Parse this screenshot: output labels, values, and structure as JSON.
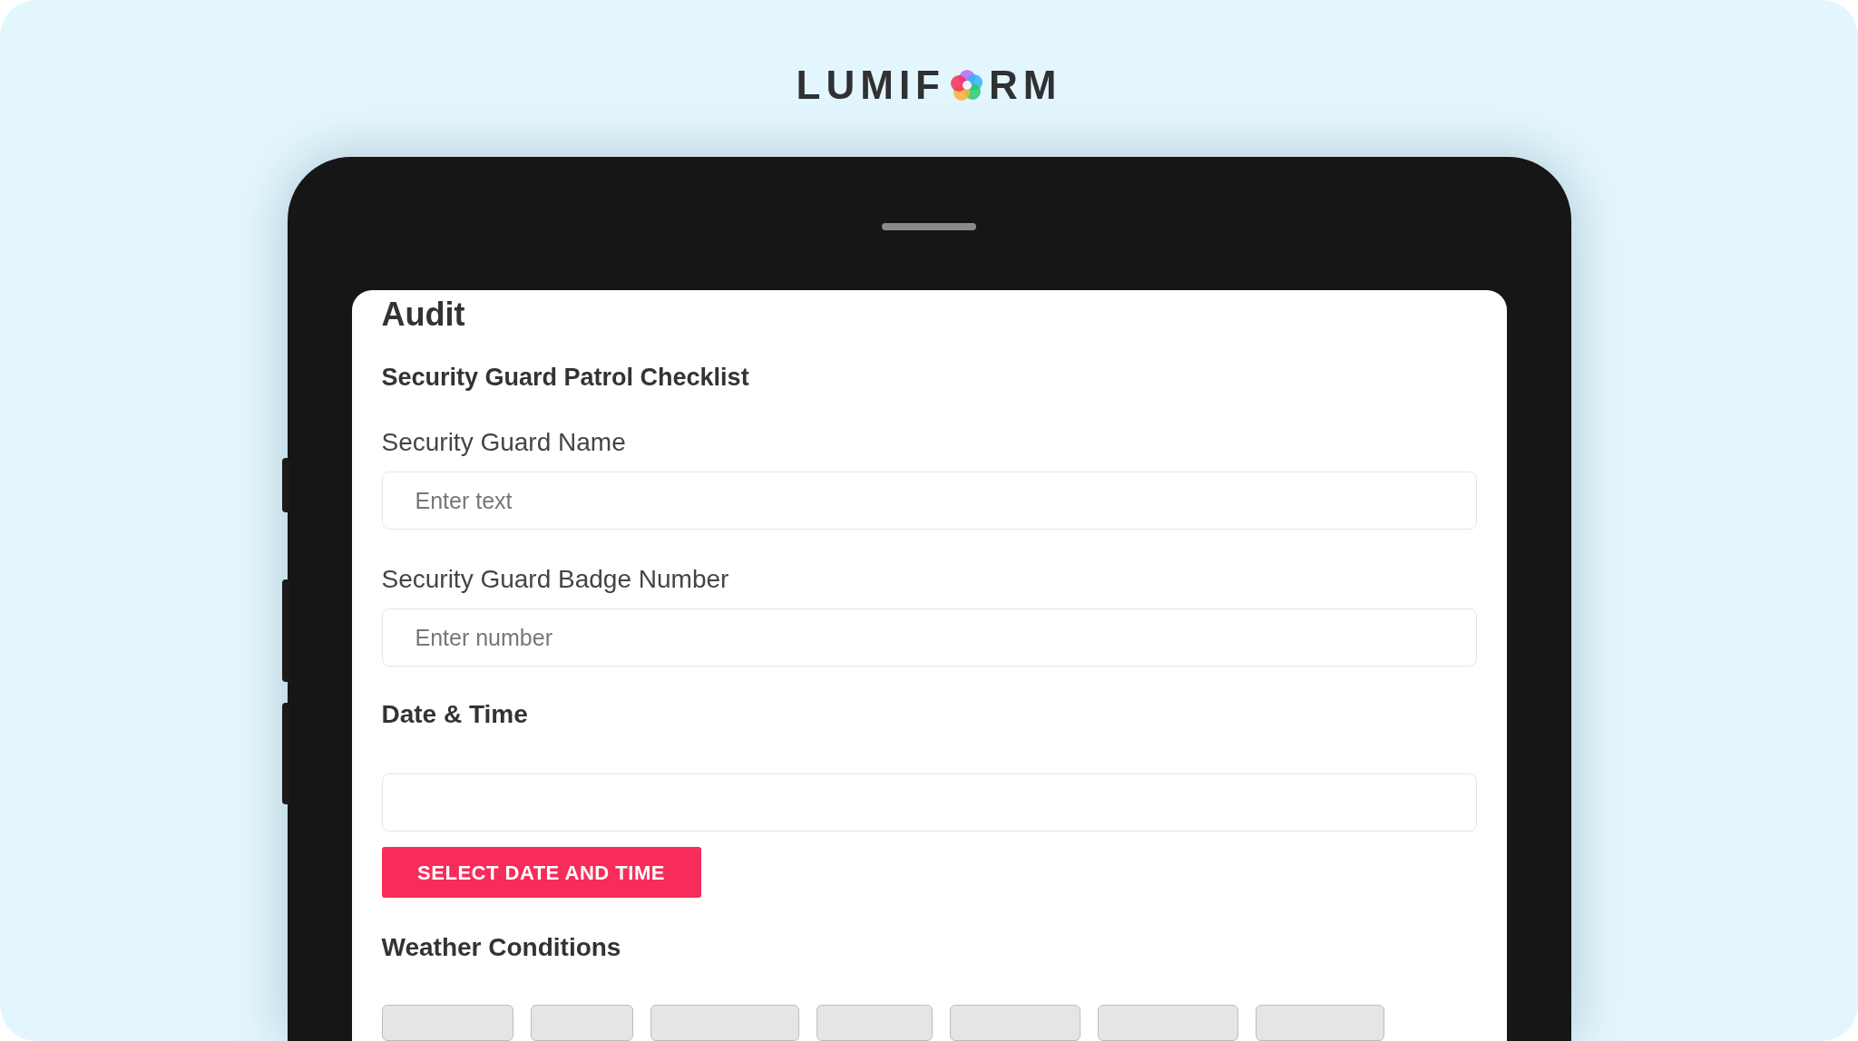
{
  "brand": {
    "before": "LUMIF",
    "after": "RM"
  },
  "form": {
    "title": "Audit",
    "subtitle": "Security Guard Patrol Checklist",
    "fields": [
      {
        "kind": "text",
        "label": "Security Guard Name",
        "placeholder": "Enter text"
      },
      {
        "kind": "text",
        "label": "Security Guard Badge Number",
        "placeholder": "Enter number"
      },
      {
        "kind": "datetime",
        "label": "Date & Time",
        "button": "SELECT DATE AND TIME"
      },
      {
        "kind": "choices",
        "label": "Weather Conditions",
        "options": [
          {
            "kind": "chip"
          },
          {
            "kind": "chip"
          },
          {
            "kind": "chip"
          },
          {
            "kind": "chip"
          },
          {
            "kind": "chip"
          },
          {
            "kind": "chip"
          },
          {
            "kind": "chip"
          }
        ]
      }
    ]
  }
}
